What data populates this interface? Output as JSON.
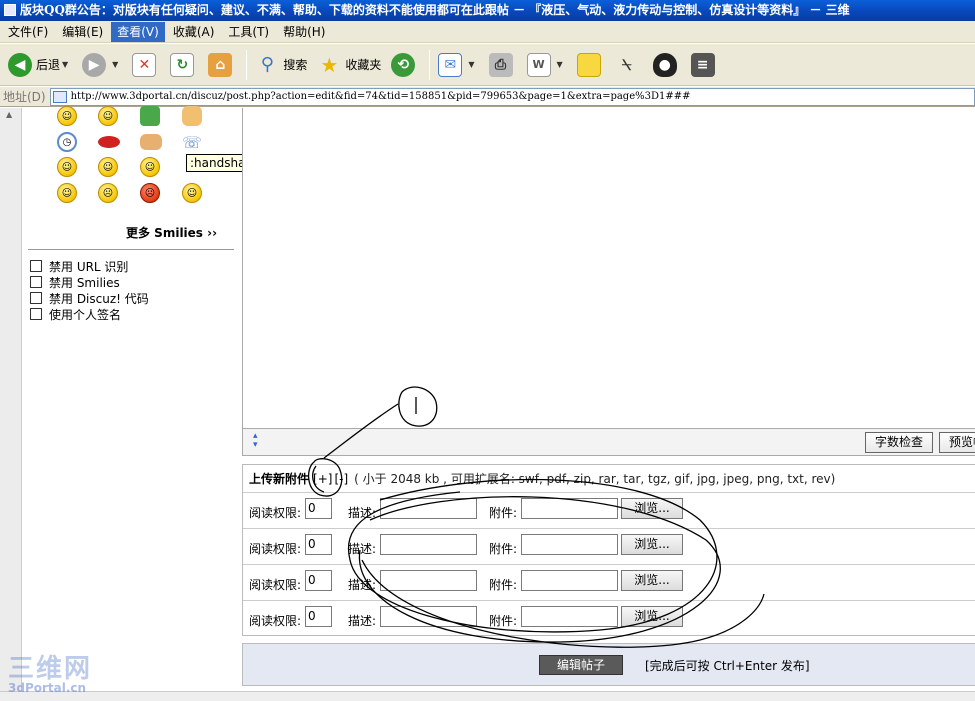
{
  "window": {
    "title": "版块QQ群公告：对版块有任何疑问、建议、不满、帮助、下载的资料不能使用都可在此跟帖 － 『液压、气动、液力传动与控制、仿真设计等资料』 － 三维"
  },
  "menu": [
    {
      "label": "文件(F)"
    },
    {
      "label": "编辑(E)"
    },
    {
      "label": "查看(V)",
      "active": true
    },
    {
      "label": "收藏(A)"
    },
    {
      "label": "工具(T)"
    },
    {
      "label": "帮助(H)"
    }
  ],
  "toolbar": {
    "back_label": "后退",
    "search_label": "搜索",
    "favorites_label": "收藏夹",
    "colors": {
      "back": "#2e9a2e",
      "forward": "#9a9a9a",
      "stop": "#d43a2a",
      "refresh": "#2e8a2e",
      "home": "#d98a2a",
      "mail": "#4a7ad0",
      "qq": "#222222",
      "icon_bg": "#3a76c8"
    },
    "icons": [
      "back-icon",
      "forward-icon",
      "stop-icon",
      "refresh-icon",
      "home-icon",
      "search-icon",
      "favorites-icon",
      "history-icon",
      "mail-icon",
      "print-icon",
      "edit-icon",
      "note-icon",
      "research-icon",
      "qq-icon",
      "archive-icon"
    ]
  },
  "address": {
    "label": "地址(D)",
    "url": "http://www.3dportal.cn/discuz/post.php?action=edit&fid=74&tid=158851&pid=799653&page=1&extra=page%3D1###"
  },
  "smilies": {
    "tooltip": ":handshake",
    "more_label": "更多 Smilies ››",
    "icons": [
      "smile-icon",
      "blush-icon",
      "flower-icon",
      "victory-icon",
      "clock-icon",
      "lips-icon",
      "handshake-icon",
      "phone-icon",
      "smile-icon",
      "grin-icon",
      "wink-icon",
      "smile-icon",
      "cry-icon",
      "angry-icon",
      "laugh-icon"
    ]
  },
  "options": [
    {
      "label": "禁用 URL 识别"
    },
    {
      "label": "禁用 Smilies"
    },
    {
      "label": "禁用 Discuz! 代码"
    },
    {
      "label": "使用个人签名"
    }
  ],
  "editor": {
    "wordcount_label": "字数检查",
    "preview_label": "预览帖"
  },
  "attachments": {
    "title": "上传新附件",
    "add_link": "[+]",
    "remove_link": "[-]",
    "note": "( 小于 2048 kb , 可用扩展名: swf, pdf, zip, rar, tar, tgz, gif, jpg, jpeg, png, txt, rev)",
    "perm_label": "阅读权限:",
    "desc_label": "描述:",
    "file_label": "附件:",
    "browse_label": "浏览...",
    "rows": [
      {
        "perm": "0"
      },
      {
        "perm": "0"
      },
      {
        "perm": "0"
      },
      {
        "perm": "0"
      }
    ]
  },
  "submit": {
    "button_label": "编辑帖子",
    "hint": "[完成后可按 Ctrl+Enter 发布]"
  },
  "watermark": {
    "big": "三维网",
    "small": "3dPortal.cn"
  }
}
